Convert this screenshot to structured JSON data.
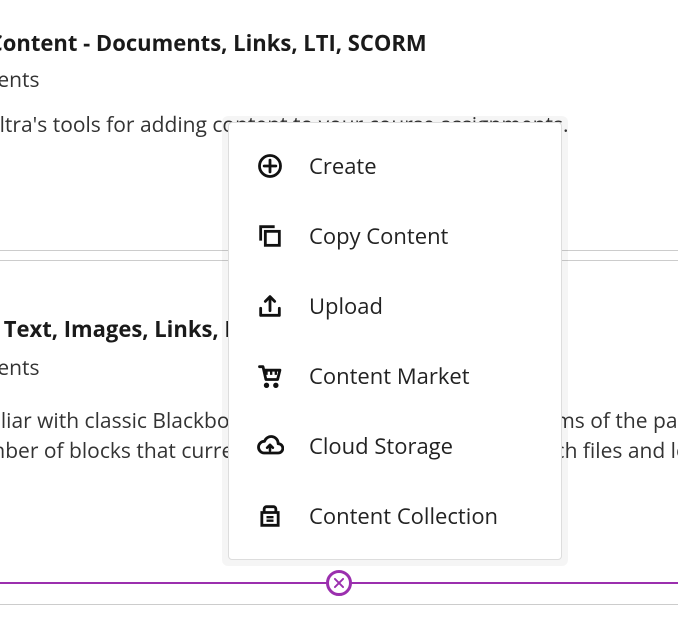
{
  "module1": {
    "title": "Using Ultra Content - Documents, Links, LTI, SCORM",
    "subtitle": "Visible to students",
    "body": "Learn about Ultra's tools for adding content to your course assignments."
  },
  "module2": {
    "title": "Documents - Text, Images, Links, Files",
    "subtitle": "Visible to students",
    "body": "If you are familiar with classic Blackboard, Documents represent the Items of the past. You can add a number of blocks that currently include: text, HTML, and attach files and local files."
  },
  "menu": {
    "items": [
      {
        "label": "Create"
      },
      {
        "label": "Copy Content"
      },
      {
        "label": "Upload"
      },
      {
        "label": "Content Market"
      },
      {
        "label": "Cloud Storage"
      },
      {
        "label": "Content Collection"
      }
    ]
  },
  "colors": {
    "accent": "#9b2fae"
  }
}
